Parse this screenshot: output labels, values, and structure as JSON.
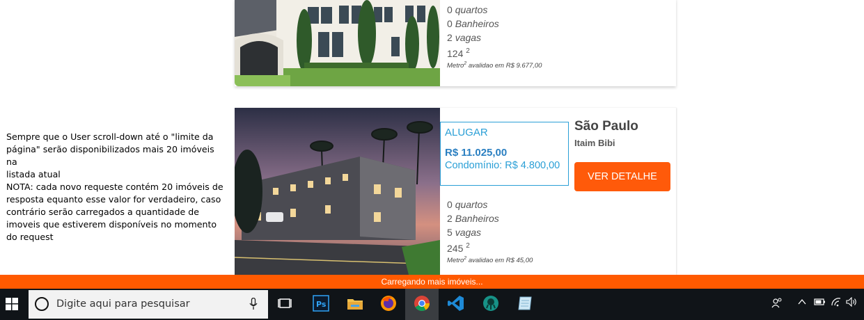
{
  "note": {
    "lines": [
      "Sempre que o User scroll-down até o \"limite da",
      "página\" serão disponibilizados mais 20 imóveis na",
      "listada atual",
      "NOTA: cada novo requeste contém 20 imóveis de",
      "resposta equanto esse valor for verdadeiro, caso",
      "contrário serão carregados a quantidade de",
      "imoveis que estiverem disponíveis no momento",
      "do request"
    ]
  },
  "listings": [
    {
      "quartos_num": "0",
      "quartos_label": "quartos",
      "banheiros_num": "0",
      "banheiros_label": "Banheiros",
      "vagas_num": "2",
      "vagas_label": "vagas",
      "area": "124",
      "area_sup": "2",
      "metro_prefix": "Metro",
      "metro_sup": "2",
      "metro_suffix": " avalidao em R$ 9.677,00"
    },
    {
      "type": "ALUGAR",
      "price": "R$ 11.025,00",
      "condominio": "Condomínio: R$ 4.800,00",
      "city": "São Paulo",
      "neighborhood": "Itaim Bibi",
      "button": "VER DETALHE",
      "quartos_num": "0",
      "quartos_label": "quartos",
      "banheiros_num": "2",
      "banheiros_label": "Banheiros",
      "vagas_num": "5",
      "vagas_label": "vagas",
      "area": "245",
      "area_sup": "2",
      "metro_prefix": "Metro",
      "metro_sup": "2",
      "metro_suffix": " avalidao em R$ 45,00"
    }
  ],
  "loading_text": "Carregando mais imóveis...",
  "taskbar": {
    "search_placeholder": "Digite aqui para pesquisar",
    "ps_label": "Ps"
  },
  "colors": {
    "accent_orange": "#ff5a0a",
    "price_blue": "#2a9fd6",
    "taskbar": "#101418"
  }
}
